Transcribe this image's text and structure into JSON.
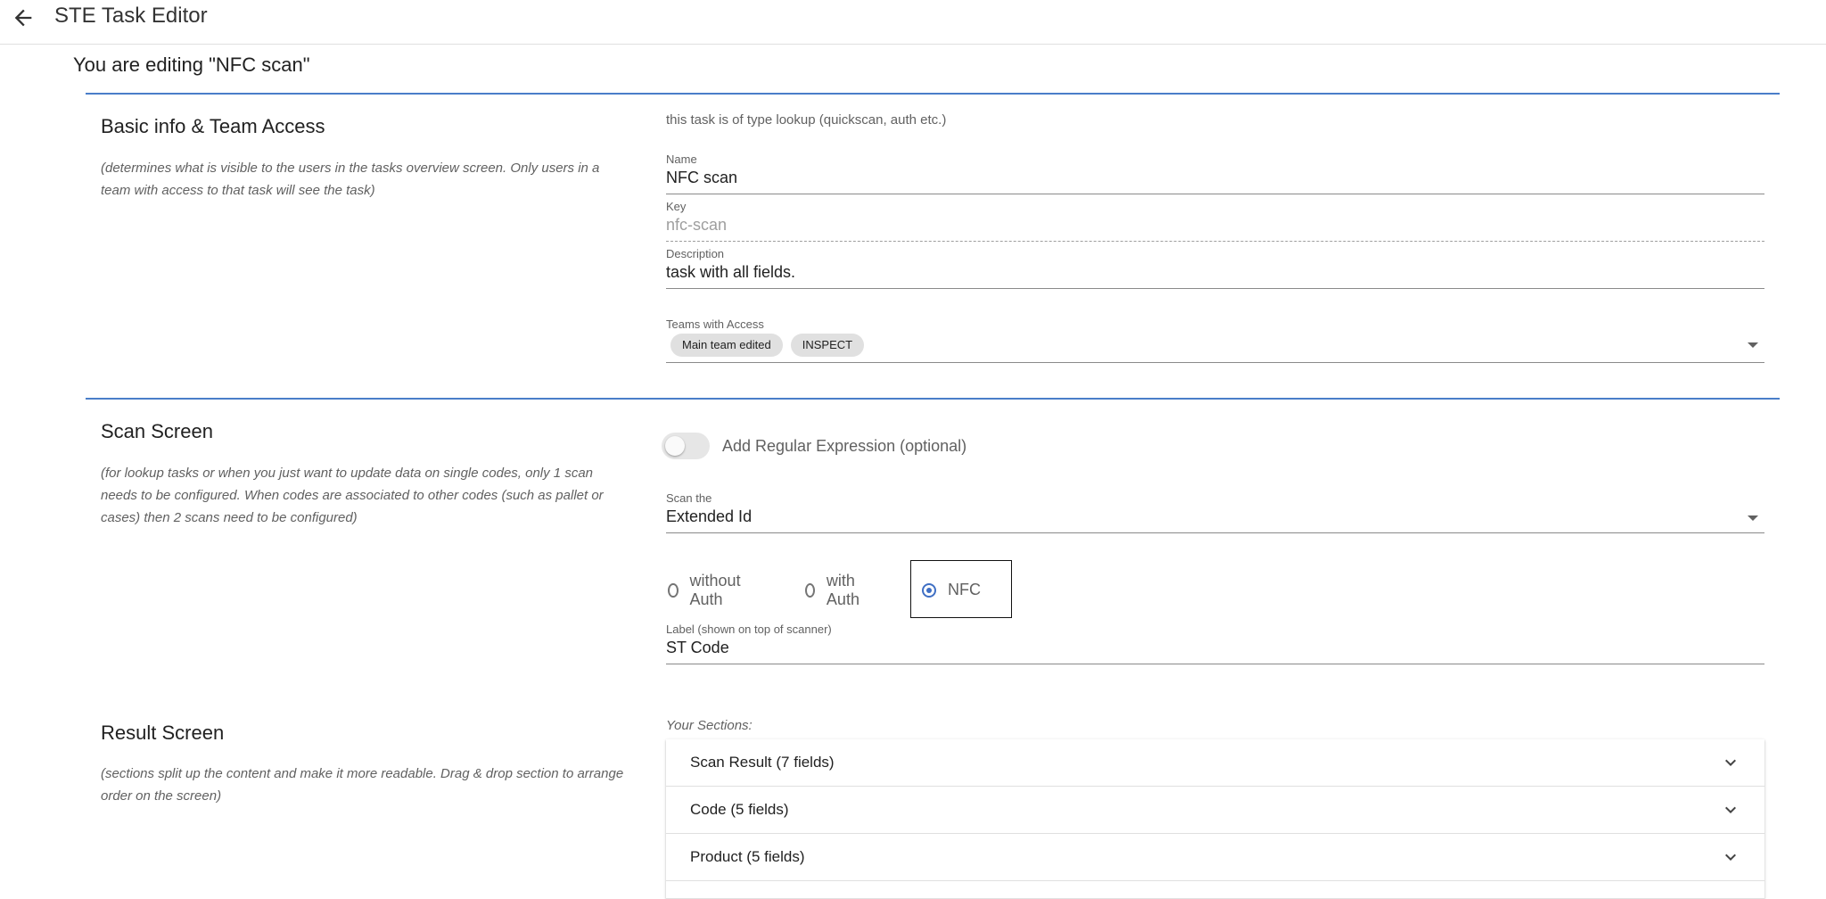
{
  "app": {
    "title": "STE Task Editor",
    "back_icon": "arrow-left-icon"
  },
  "editing_title": "You are editing \"NFC scan\"",
  "basic": {
    "title": "Basic info & Team Access",
    "description": "(determines what is visible to the users in the tasks overview screen. Only users in a team with access to that task will see the task)",
    "type_note": "this task is of type lookup (quickscan, auth etc.)",
    "name": {
      "label": "Name",
      "value": "NFC scan"
    },
    "key": {
      "label": "Key",
      "value": "nfc-scan"
    },
    "description_field": {
      "label": "Description",
      "value": "task with all fields."
    },
    "teams": {
      "label": "Teams with Access",
      "chips": [
        "Main team edited",
        "INSPECT"
      ]
    }
  },
  "scan": {
    "title": "Scan Screen",
    "description": "(for lookup tasks or when you just want to update data on single codes, only 1 scan needs to be configured. When codes are associated to other codes (such as pallet or cases) then 2 scans need to be configured)",
    "regex_toggle": {
      "label": "Add Regular Expression (optional)",
      "on": false
    },
    "scan_the": {
      "label": "Scan the",
      "value": "Extended Id"
    },
    "auth_options": [
      "without Auth",
      "with Auth",
      "NFC"
    ],
    "auth_selected": "NFC",
    "scanner_label": {
      "label": "Label (shown on top of scanner)",
      "value": "ST Code"
    }
  },
  "result": {
    "title": "Result Screen",
    "description": "(sections split up the content and make it more readable. Drag & drop section to arrange order on the screen)",
    "sections_label": "Your Sections:",
    "sections": [
      "Scan Result (7 fields)",
      "Code (5 fields)",
      "Product (5 fields)"
    ]
  },
  "colors": {
    "accent": "#4a7ec9",
    "radio_checked": "#3f6fc4"
  }
}
